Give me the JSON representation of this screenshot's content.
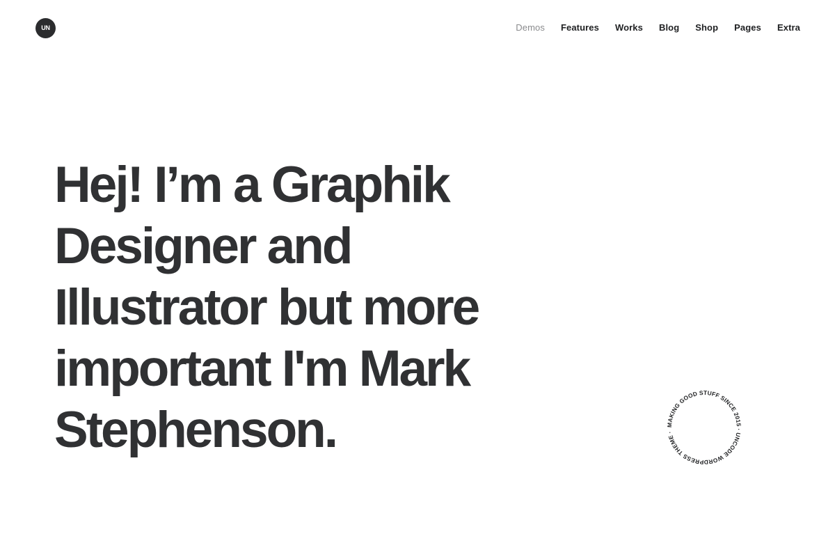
{
  "header": {
    "logo_text": "UN",
    "nav": [
      {
        "label": "Demos",
        "active": true
      },
      {
        "label": "Features",
        "active": false
      },
      {
        "label": "Works",
        "active": false
      },
      {
        "label": "Blog",
        "active": false
      },
      {
        "label": "Shop",
        "active": false
      },
      {
        "label": "Pages",
        "active": false
      },
      {
        "label": "Extra",
        "active": false
      }
    ]
  },
  "hero": {
    "lines": [
      "Hej! I’m a Graphik",
      "Designer and",
      "Illustrator but more",
      "important I'm Mark",
      "Stephenson."
    ]
  },
  "badge": {
    "text": "MAKING GOOD STUFF SINCE 2015 · UNCODE WORDPRESS THEME · "
  },
  "colors": {
    "background": "#ffffff",
    "text": "#303133",
    "nav_active": "#8a8b8d",
    "logo_bg": "#2b2c2e"
  }
}
